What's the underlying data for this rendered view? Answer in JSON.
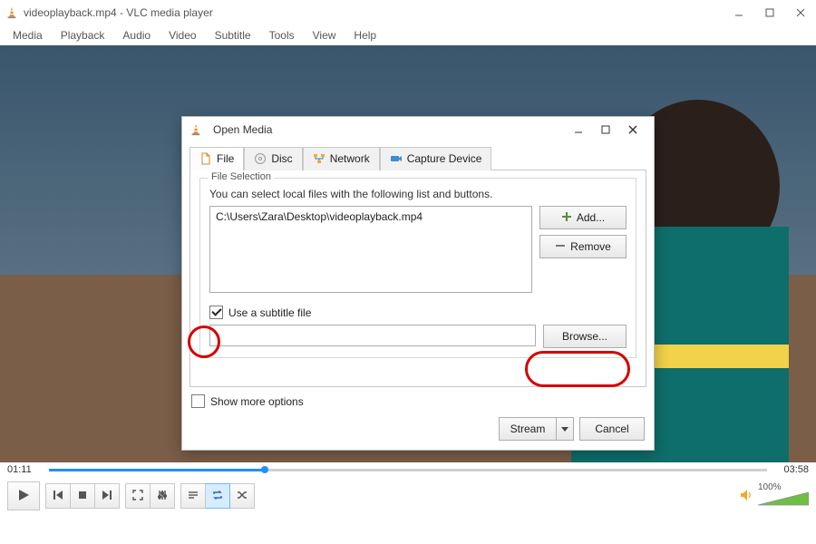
{
  "titlebar": {
    "title": "videoplayback.mp4 - VLC media player"
  },
  "menu": {
    "items": [
      "Media",
      "Playback",
      "Audio",
      "Video",
      "Subtitle",
      "Tools",
      "View",
      "Help"
    ]
  },
  "dialog": {
    "title": "Open Media",
    "tabs": {
      "file": "File",
      "disc": "Disc",
      "network": "Network",
      "capture": "Capture Device"
    },
    "fileselection": {
      "legend": "File Selection",
      "hint": "You can select local files with the following list and buttons.",
      "entry": "C:\\Users\\Zara\\Desktop\\videoplayback.mp4",
      "add": "Add...",
      "remove": "Remove"
    },
    "subtitle": {
      "use_label": "Use a subtitle file",
      "use_checked": true,
      "browse": "Browse..."
    },
    "more": "Show more options",
    "actions": {
      "stream": "Stream",
      "cancel": "Cancel"
    }
  },
  "player": {
    "elapsed": "01:11",
    "total": "03:58",
    "progress_pct": 30,
    "volume_pct_label": "100%"
  }
}
